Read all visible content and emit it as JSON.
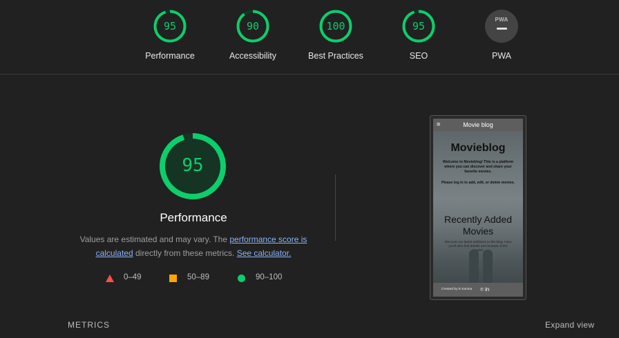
{
  "gauges": [
    {
      "score": "95",
      "label": "Performance",
      "value": 95
    },
    {
      "score": "90",
      "label": "Accessibility",
      "value": 90
    },
    {
      "score": "100",
      "label": "Best Practices",
      "value": 100
    },
    {
      "score": "95",
      "label": "SEO",
      "value": 95
    },
    {
      "badge": "PWA",
      "label": "PWA"
    }
  ],
  "main": {
    "score": "95",
    "value": 95,
    "title": "Performance",
    "desc_prefix": "Values are estimated and may vary. The ",
    "desc_link1": "performance score is calculated",
    "desc_middle": " directly from these metrics. ",
    "desc_link2": "See calculator.",
    "legend": {
      "fail": "0–49",
      "average": "50–89",
      "pass": "90–100"
    }
  },
  "screenshot": {
    "nav_title": "Movie blog",
    "hamburger": "≡",
    "heading": "Movieblog",
    "intro": "Welcome to Movieblog! This is a platform where you can discover and share your favorite movies.",
    "login_hint": "Please log in to add, edit, or delete movies.",
    "section_title": "Recently Added Movies",
    "section_text": "Discover our latest additions to the blog. Here you'll also find details and reviews of the movies.",
    "footer_text": "Created by E.Kanina",
    "footer_icons": "⌾ in"
  },
  "footer": {
    "metrics": "METRICS",
    "expand": "Expand view"
  },
  "colors": {
    "pass": "#0cce6b",
    "average": "#ffa400",
    "fail": "#ff4e42",
    "background": "#212121",
    "link": "#8ab4f8"
  }
}
